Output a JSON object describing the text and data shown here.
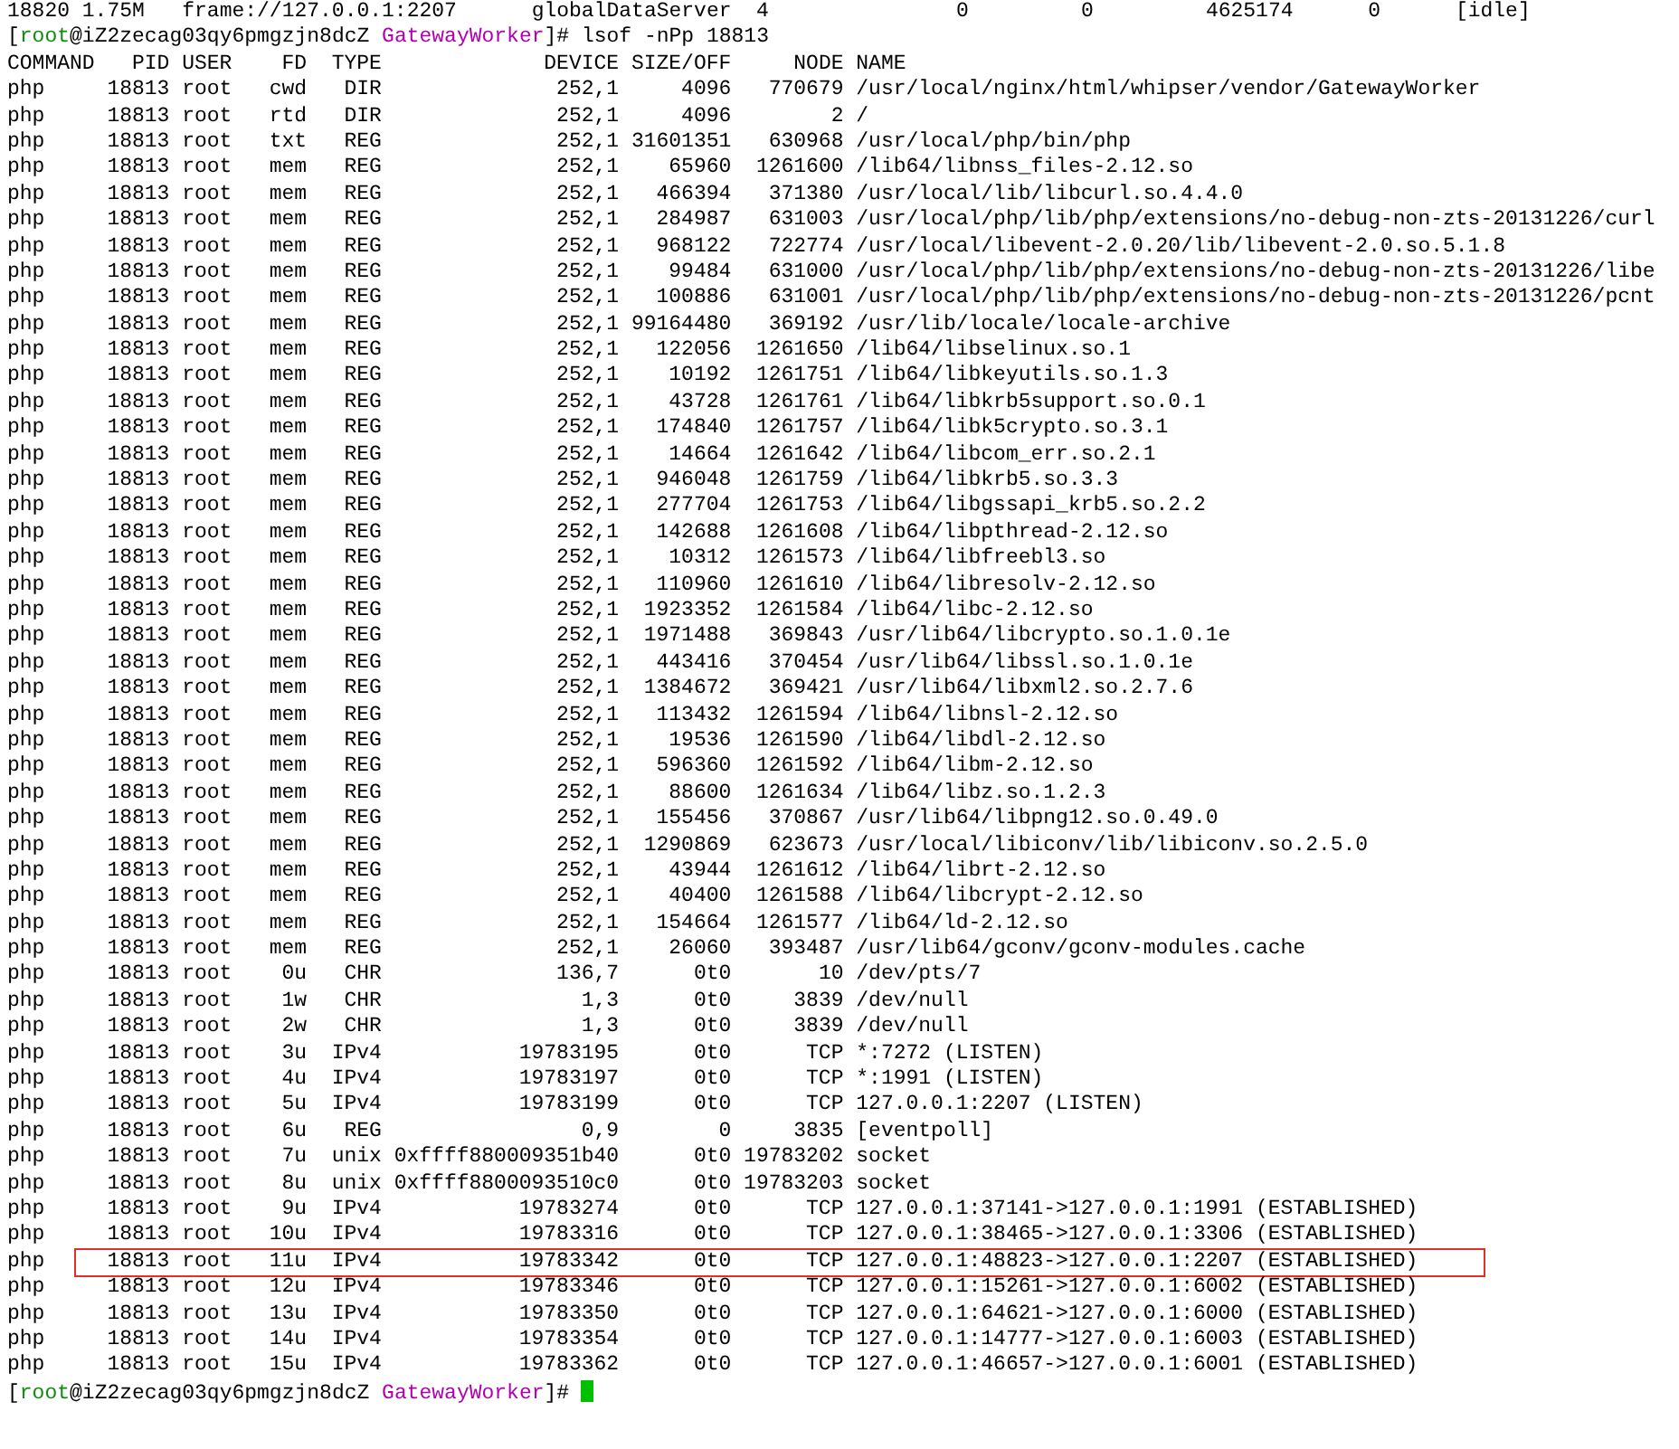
{
  "process_line": [
    "18820",
    "1.75M",
    "frame://127.0.0.1:2207",
    "globalDataServer",
    "4",
    "0",
    "0",
    "4625174",
    "0",
    "[idle]"
  ],
  "prompt": {
    "open": "[",
    "user": "root",
    "host": "@iZ2zecag03qy6pmgzjn8dcZ",
    "dir": "GatewayWorker",
    "close": "]#",
    "command": "lsof -nPp 18813"
  },
  "table": {
    "columns": [
      "COMMAND",
      "PID",
      "USER",
      "FD",
      "TYPE",
      "DEVICE",
      "SIZE/OFF",
      "NODE",
      "NAME"
    ],
    "rows": [
      {
        "cells": [
          "php",
          "18813",
          "root",
          "cwd",
          "DIR",
          "252,1",
          "4096",
          "770679",
          "/usr/local/nginx/html/whipser/vendor/GatewayWorker"
        ],
        "highlighted": false
      },
      {
        "cells": [
          "php",
          "18813",
          "root",
          "rtd",
          "DIR",
          "252,1",
          "4096",
          "2",
          "/"
        ],
        "highlighted": false
      },
      {
        "cells": [
          "php",
          "18813",
          "root",
          "txt",
          "REG",
          "252,1",
          "31601351",
          "630968",
          "/usr/local/php/bin/php"
        ],
        "highlighted": false
      },
      {
        "cells": [
          "php",
          "18813",
          "root",
          "mem",
          "REG",
          "252,1",
          "65960",
          "1261600",
          "/lib64/libnss_files-2.12.so"
        ],
        "highlighted": false
      },
      {
        "cells": [
          "php",
          "18813",
          "root",
          "mem",
          "REG",
          "252,1",
          "466394",
          "371380",
          "/usr/local/lib/libcurl.so.4.4.0"
        ],
        "highlighted": false
      },
      {
        "cells": [
          "php",
          "18813",
          "root",
          "mem",
          "REG",
          "252,1",
          "284987",
          "631003",
          "/usr/local/php/lib/php/extensions/no-debug-non-zts-20131226/curl"
        ],
        "highlighted": false
      },
      {
        "cells": [
          "php",
          "18813",
          "root",
          "mem",
          "REG",
          "252,1",
          "968122",
          "722774",
          "/usr/local/libevent-2.0.20/lib/libevent-2.0.so.5.1.8"
        ],
        "highlighted": false
      },
      {
        "cells": [
          "php",
          "18813",
          "root",
          "mem",
          "REG",
          "252,1",
          "99484",
          "631000",
          "/usr/local/php/lib/php/extensions/no-debug-non-zts-20131226/libe"
        ],
        "highlighted": false
      },
      {
        "cells": [
          "php",
          "18813",
          "root",
          "mem",
          "REG",
          "252,1",
          "100886",
          "631001",
          "/usr/local/php/lib/php/extensions/no-debug-non-zts-20131226/pcnt"
        ],
        "highlighted": false
      },
      {
        "cells": [
          "php",
          "18813",
          "root",
          "mem",
          "REG",
          "252,1",
          "99164480",
          "369192",
          "/usr/lib/locale/locale-archive"
        ],
        "highlighted": false
      },
      {
        "cells": [
          "php",
          "18813",
          "root",
          "mem",
          "REG",
          "252,1",
          "122056",
          "1261650",
          "/lib64/libselinux.so.1"
        ],
        "highlighted": false
      },
      {
        "cells": [
          "php",
          "18813",
          "root",
          "mem",
          "REG",
          "252,1",
          "10192",
          "1261751",
          "/lib64/libkeyutils.so.1.3"
        ],
        "highlighted": false
      },
      {
        "cells": [
          "php",
          "18813",
          "root",
          "mem",
          "REG",
          "252,1",
          "43728",
          "1261761",
          "/lib64/libkrb5support.so.0.1"
        ],
        "highlighted": false
      },
      {
        "cells": [
          "php",
          "18813",
          "root",
          "mem",
          "REG",
          "252,1",
          "174840",
          "1261757",
          "/lib64/libk5crypto.so.3.1"
        ],
        "highlighted": false
      },
      {
        "cells": [
          "php",
          "18813",
          "root",
          "mem",
          "REG",
          "252,1",
          "14664",
          "1261642",
          "/lib64/libcom_err.so.2.1"
        ],
        "highlighted": false
      },
      {
        "cells": [
          "php",
          "18813",
          "root",
          "mem",
          "REG",
          "252,1",
          "946048",
          "1261759",
          "/lib64/libkrb5.so.3.3"
        ],
        "highlighted": false
      },
      {
        "cells": [
          "php",
          "18813",
          "root",
          "mem",
          "REG",
          "252,1",
          "277704",
          "1261753",
          "/lib64/libgssapi_krb5.so.2.2"
        ],
        "highlighted": false
      },
      {
        "cells": [
          "php",
          "18813",
          "root",
          "mem",
          "REG",
          "252,1",
          "142688",
          "1261608",
          "/lib64/libpthread-2.12.so"
        ],
        "highlighted": false
      },
      {
        "cells": [
          "php",
          "18813",
          "root",
          "mem",
          "REG",
          "252,1",
          "10312",
          "1261573",
          "/lib64/libfreebl3.so"
        ],
        "highlighted": false
      },
      {
        "cells": [
          "php",
          "18813",
          "root",
          "mem",
          "REG",
          "252,1",
          "110960",
          "1261610",
          "/lib64/libresolv-2.12.so"
        ],
        "highlighted": false
      },
      {
        "cells": [
          "php",
          "18813",
          "root",
          "mem",
          "REG",
          "252,1",
          "1923352",
          "1261584",
          "/lib64/libc-2.12.so"
        ],
        "highlighted": false
      },
      {
        "cells": [
          "php",
          "18813",
          "root",
          "mem",
          "REG",
          "252,1",
          "1971488",
          "369843",
          "/usr/lib64/libcrypto.so.1.0.1e"
        ],
        "highlighted": false
      },
      {
        "cells": [
          "php",
          "18813",
          "root",
          "mem",
          "REG",
          "252,1",
          "443416",
          "370454",
          "/usr/lib64/libssl.so.1.0.1e"
        ],
        "highlighted": false
      },
      {
        "cells": [
          "php",
          "18813",
          "root",
          "mem",
          "REG",
          "252,1",
          "1384672",
          "369421",
          "/usr/lib64/libxml2.so.2.7.6"
        ],
        "highlighted": false
      },
      {
        "cells": [
          "php",
          "18813",
          "root",
          "mem",
          "REG",
          "252,1",
          "113432",
          "1261594",
          "/lib64/libnsl-2.12.so"
        ],
        "highlighted": false
      },
      {
        "cells": [
          "php",
          "18813",
          "root",
          "mem",
          "REG",
          "252,1",
          "19536",
          "1261590",
          "/lib64/libdl-2.12.so"
        ],
        "highlighted": false
      },
      {
        "cells": [
          "php",
          "18813",
          "root",
          "mem",
          "REG",
          "252,1",
          "596360",
          "1261592",
          "/lib64/libm-2.12.so"
        ],
        "highlighted": false
      },
      {
        "cells": [
          "php",
          "18813",
          "root",
          "mem",
          "REG",
          "252,1",
          "88600",
          "1261634",
          "/lib64/libz.so.1.2.3"
        ],
        "highlighted": false
      },
      {
        "cells": [
          "php",
          "18813",
          "root",
          "mem",
          "REG",
          "252,1",
          "155456",
          "370867",
          "/usr/lib64/libpng12.so.0.49.0"
        ],
        "highlighted": false
      },
      {
        "cells": [
          "php",
          "18813",
          "root",
          "mem",
          "REG",
          "252,1",
          "1290869",
          "623673",
          "/usr/local/libiconv/lib/libiconv.so.2.5.0"
        ],
        "highlighted": false
      },
      {
        "cells": [
          "php",
          "18813",
          "root",
          "mem",
          "REG",
          "252,1",
          "43944",
          "1261612",
          "/lib64/librt-2.12.so"
        ],
        "highlighted": false
      },
      {
        "cells": [
          "php",
          "18813",
          "root",
          "mem",
          "REG",
          "252,1",
          "40400",
          "1261588",
          "/lib64/libcrypt-2.12.so"
        ],
        "highlighted": false
      },
      {
        "cells": [
          "php",
          "18813",
          "root",
          "mem",
          "REG",
          "252,1",
          "154664",
          "1261577",
          "/lib64/ld-2.12.so"
        ],
        "highlighted": false
      },
      {
        "cells": [
          "php",
          "18813",
          "root",
          "mem",
          "REG",
          "252,1",
          "26060",
          "393487",
          "/usr/lib64/gconv/gconv-modules.cache"
        ],
        "highlighted": false
      },
      {
        "cells": [
          "php",
          "18813",
          "root",
          "0u",
          "CHR",
          "136,7",
          "0t0",
          "10",
          "/dev/pts/7"
        ],
        "highlighted": false
      },
      {
        "cells": [
          "php",
          "18813",
          "root",
          "1w",
          "CHR",
          "1,3",
          "0t0",
          "3839",
          "/dev/null"
        ],
        "highlighted": false
      },
      {
        "cells": [
          "php",
          "18813",
          "root",
          "2w",
          "CHR",
          "1,3",
          "0t0",
          "3839",
          "/dev/null"
        ],
        "highlighted": false
      },
      {
        "cells": [
          "php",
          "18813",
          "root",
          "3u",
          "IPv4",
          "19783195",
          "0t0",
          "TCP",
          "*:7272 (LISTEN)"
        ],
        "highlighted": false
      },
      {
        "cells": [
          "php",
          "18813",
          "root",
          "4u",
          "IPv4",
          "19783197",
          "0t0",
          "TCP",
          "*:1991 (LISTEN)"
        ],
        "highlighted": false
      },
      {
        "cells": [
          "php",
          "18813",
          "root",
          "5u",
          "IPv4",
          "19783199",
          "0t0",
          "TCP",
          "127.0.0.1:2207 (LISTEN)"
        ],
        "highlighted": false
      },
      {
        "cells": [
          "php",
          "18813",
          "root",
          "6u",
          "REG",
          "0,9",
          "0",
          "3835",
          "[eventpoll]"
        ],
        "highlighted": false
      },
      {
        "cells": [
          "php",
          "18813",
          "root",
          "7u",
          "unix",
          "0xffff880009351b40",
          "0t0",
          "19783202",
          "socket"
        ],
        "highlighted": false
      },
      {
        "cells": [
          "php",
          "18813",
          "root",
          "8u",
          "unix",
          "0xffff8800093510c0",
          "0t0",
          "19783203",
          "socket"
        ],
        "highlighted": false
      },
      {
        "cells": [
          "php",
          "18813",
          "root",
          "9u",
          "IPv4",
          "19783274",
          "0t0",
          "TCP",
          "127.0.0.1:37141->127.0.0.1:1991 (ESTABLISHED)"
        ],
        "highlighted": false
      },
      {
        "cells": [
          "php",
          "18813",
          "root",
          "10u",
          "IPv4",
          "19783316",
          "0t0",
          "TCP",
          "127.0.0.1:38465->127.0.0.1:3306 (ESTABLISHED)"
        ],
        "highlighted": false
      },
      {
        "cells": [
          "php",
          "18813",
          "root",
          "11u",
          "IPv4",
          "19783342",
          "0t0",
          "TCP",
          "127.0.0.1:48823->127.0.0.1:2207 (ESTABLISHED)"
        ],
        "highlighted": true
      },
      {
        "cells": [
          "php",
          "18813",
          "root",
          "12u",
          "IPv4",
          "19783346",
          "0t0",
          "TCP",
          "127.0.0.1:15261->127.0.0.1:6002 (ESTABLISHED)"
        ],
        "highlighted": false
      },
      {
        "cells": [
          "php",
          "18813",
          "root",
          "13u",
          "IPv4",
          "19783350",
          "0t0",
          "TCP",
          "127.0.0.1:64621->127.0.0.1:6000 (ESTABLISHED)"
        ],
        "highlighted": false
      },
      {
        "cells": [
          "php",
          "18813",
          "root",
          "14u",
          "IPv4",
          "19783354",
          "0t0",
          "TCP",
          "127.0.0.1:14777->127.0.0.1:6003 (ESTABLISHED)"
        ],
        "highlighted": false
      },
      {
        "cells": [
          "php",
          "18813",
          "root",
          "15u",
          "IPv4",
          "19783362",
          "0t0",
          "TCP",
          "127.0.0.1:46657->127.0.0.1:6001 (ESTABLISHED)"
        ],
        "highlighted": false
      }
    ]
  },
  "final_prompt": {
    "open": "[",
    "user": "root",
    "host": "@iZ2zecag03qy6pmgzjn8dcZ",
    "dir": "GatewayWorker",
    "close": "]#",
    "cursor": true
  }
}
